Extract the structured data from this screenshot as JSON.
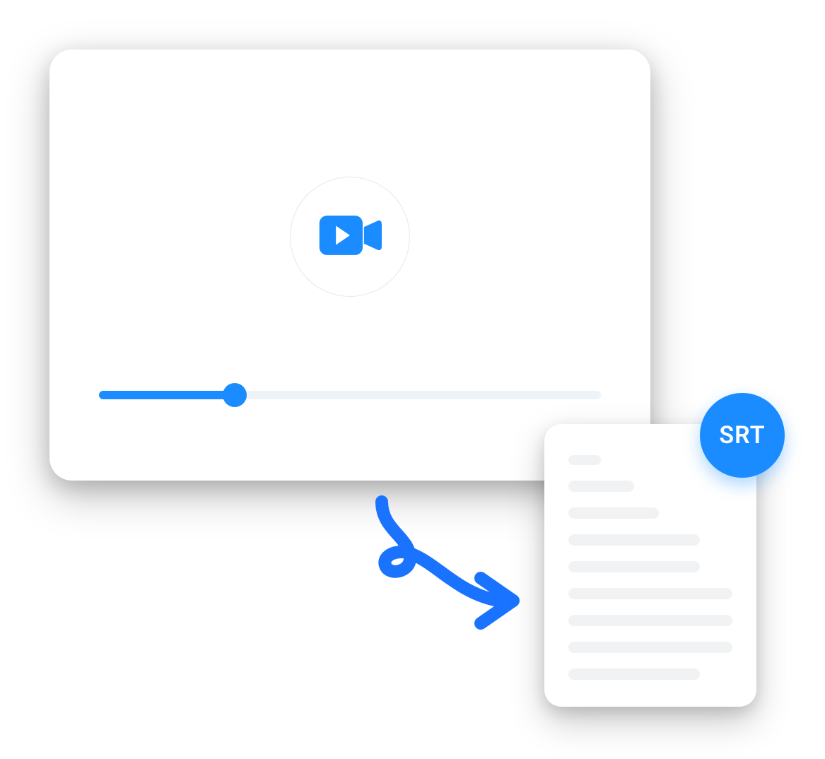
{
  "colors": {
    "accent": "#1a8cff",
    "track": "#eef3f8",
    "line": "#f0f2f4",
    "card_bg": "#ffffff"
  },
  "player": {
    "progress_percent": 27
  },
  "badge": {
    "label": "SRT"
  }
}
